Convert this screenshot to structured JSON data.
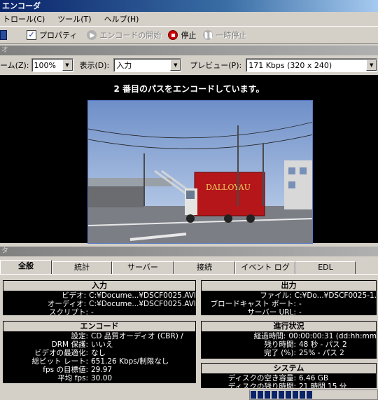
{
  "window": {
    "title": "エンコーダ"
  },
  "menu": [
    "トロール(C)",
    "ツール(T)",
    "ヘルプ(H)"
  ],
  "toolbar": {
    "properties": "プロパティ",
    "start": "エンコードの開始",
    "stop": "停止",
    "pause": "一時停止"
  },
  "video_section": {
    "header": "オ",
    "zoom_label": "ーム(Z):",
    "zoom_value": "100%",
    "display_label": "表示(D):",
    "display_value": "入力",
    "preview_label": "プレビュー(P):",
    "preview_value": "171 Kbps (320 x 240)"
  },
  "status_text": "2 番目のパスをエンコードしています。",
  "frame_text": {
    "truck_brand": "DALLOYAU"
  },
  "monitor_header": "タ",
  "tabs": [
    "全般",
    "統計",
    "サーバー",
    "接続",
    "イベント ログ",
    "EDL"
  ],
  "input": {
    "title": "入力",
    "rows": [
      {
        "k": "ビデオ:",
        "v": "C:¥Docume...¥DSCF0025.AVI"
      },
      {
        "k": "オーディオ:",
        "v": "C:¥Docume...¥DSCF0025.AVI"
      },
      {
        "k": "スクリプト:",
        "v": "-"
      }
    ]
  },
  "output": {
    "title": "出力",
    "rows": [
      {
        "k": "ファイル:",
        "v": "C:¥Do...¥DSCF0025-1."
      },
      {
        "k": "ブロードキャスト ポート:",
        "v": "-"
      },
      {
        "k": "サーバー URL:",
        "v": "-"
      }
    ]
  },
  "encode": {
    "title": "エンコード",
    "rows": [
      {
        "k": "設定:",
        "v": "CD 品質オーディオ (CBR) /"
      },
      {
        "k": "DRM 保護:",
        "v": "いいえ"
      },
      {
        "k": "ビデオの最適化:",
        "v": "なし"
      },
      {
        "k": "総ビット レート:",
        "v": "651.26 Kbps/制限なし"
      },
      {
        "k": "fps の目標値:",
        "v": "29.97"
      },
      {
        "k": "平均 fps:",
        "v": "30.00"
      }
    ]
  },
  "progress": {
    "title": "進行状況",
    "rows": [
      {
        "k": "経過時間:",
        "v": "00:00:00:31 (dd:hh:mm"
      },
      {
        "k": "残り時間:",
        "v": "48 秒 - パス 2"
      },
      {
        "k": "完了 (%):",
        "v": "25% - パス 2"
      }
    ]
  },
  "system": {
    "title": "システム",
    "rows": [
      {
        "k": "ディスクの空き容量:",
        "v": "6.46 GB"
      },
      {
        "k": "ディスクの残り時間:",
        "v": "21 時間 15 分"
      }
    ]
  },
  "progress_fraction": 0.25,
  "colors": {
    "title_bar": "#0a246a",
    "panel_bg": "#000000",
    "progress": "#0a246a"
  }
}
